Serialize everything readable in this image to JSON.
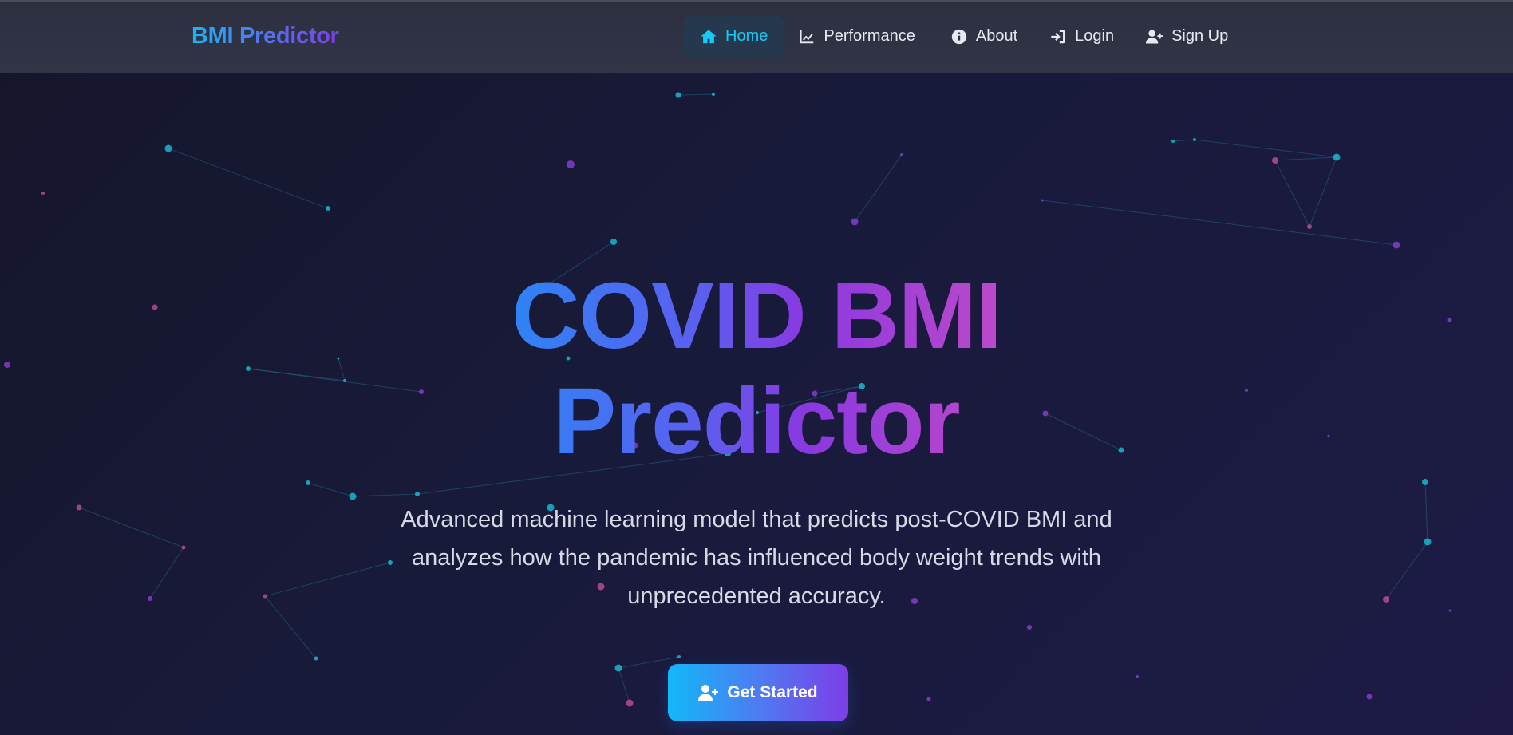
{
  "app": {
    "brand": "BMI Predictor"
  },
  "nav": {
    "items": [
      {
        "label": "Home",
        "icon": "home-icon",
        "active": true
      },
      {
        "label": "Performance",
        "icon": "chart-line-icon",
        "active": false
      },
      {
        "label": "About",
        "icon": "info-circle-icon",
        "active": false
      },
      {
        "label": "Login",
        "icon": "sign-in-icon",
        "active": false
      },
      {
        "label": "Sign Up",
        "icon": "user-plus-icon",
        "active": false
      }
    ]
  },
  "hero": {
    "title_line1": "COVID BMI",
    "title_line2": "Predictor",
    "subtitle": "Advanced machine learning model that predicts post-COVID BMI and analyzes how the pandemic has influenced body weight trends with unprecedented accuracy.",
    "cta_label": "Get Started",
    "cta_icon": "user-plus-icon"
  },
  "colors": {
    "accent_cyan": "#18c8f5",
    "accent_purple": "#7c3ee6",
    "accent_pink": "#c44cc6",
    "background": "#181a3a",
    "navbar": "#2f3244"
  }
}
